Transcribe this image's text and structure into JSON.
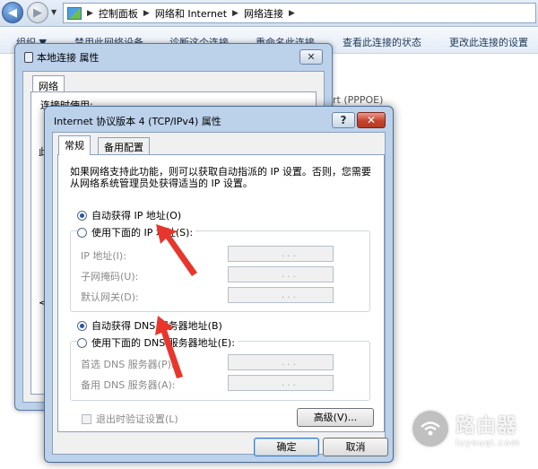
{
  "explorer": {
    "breadcrumbs": [
      "控制面板",
      "网络和 Internet",
      "网络连接"
    ],
    "toolbar": [
      {
        "label": "组织 ▼"
      },
      {
        "label": "禁用此网络设备"
      },
      {
        "label": "诊断这个连接"
      },
      {
        "label": "重命名此连接"
      },
      {
        "label": "查看此连接的状态"
      },
      {
        "label": "更改此连接的设置"
      }
    ],
    "background_fragment": "rt (PPPOE)"
  },
  "local_dialog": {
    "title": "本地连接 属性",
    "close": "✕",
    "tab": "网络",
    "connect_using": "连接时使用:",
    "fragment_1": "此",
    "fragment_2": "<"
  },
  "ipv4_dialog": {
    "title": "Internet 协议版本 4 (TCP/IPv4) 属性",
    "help": "?",
    "close": "✕",
    "tabs": [
      {
        "label": "常规"
      },
      {
        "label": "备用配置"
      }
    ],
    "description": "如果网络支持此功能，则可以获取自动指派的 IP 设置。否则，您需要从网络系统管理员处获得适当的 IP 设置。",
    "ip_auto": {
      "label": "自动获得 IP 地址(O)",
      "checked": true
    },
    "ip_manual": {
      "label": "使用下面的 IP 地址(S):",
      "checked": false
    },
    "ip_fields": [
      {
        "label": "IP 地址(I):",
        "value": ". . ."
      },
      {
        "label": "子网掩码(U):",
        "value": ". . ."
      },
      {
        "label": "默认网关(D):",
        "value": ". . ."
      }
    ],
    "dns_auto": {
      "label": "自动获得 DNS 服务器地址(B)",
      "checked": true
    },
    "dns_manual": {
      "label": "使用下面的 DNS 服务器地址(E):",
      "checked": false
    },
    "dns_fields": [
      {
        "label": "首选 DNS 服务器(P):",
        "value": ". . ."
      },
      {
        "label": "备用 DNS 服务器(A):",
        "value": ". . ."
      }
    ],
    "validate_on_exit": {
      "label": "退出时验证设置(L)",
      "checked": false
    },
    "advanced_button": "高级(V)...",
    "ok_button": "确定",
    "cancel_button": "取消"
  },
  "watermark": {
    "title": "路由器",
    "subtitle": "luyouqi.com"
  },
  "colors": {
    "annotation_arrow": "#e8362c",
    "dialog_frame": "#bcd1ea"
  }
}
